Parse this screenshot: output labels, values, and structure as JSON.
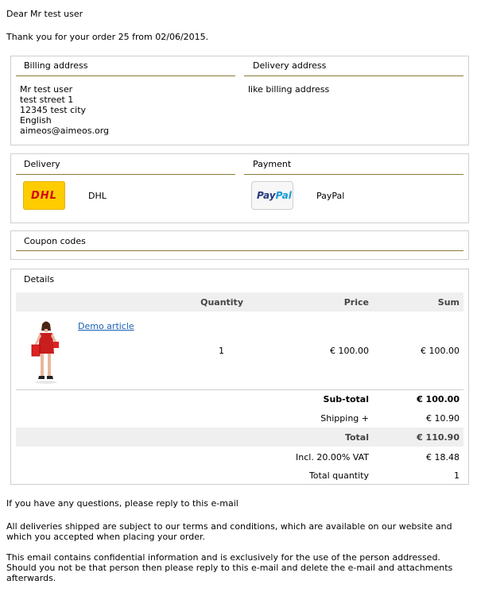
{
  "greeting": "Dear Mr test user",
  "thanks": "Thank you for your order 25 from 02/06/2015.",
  "billing": {
    "title": "Billing address",
    "lines": [
      "Mr test user",
      "test street 1",
      "12345 test city",
      "English",
      "aimeos@aimeos.org"
    ]
  },
  "delivery_address": {
    "title": "Delivery address",
    "text": "like billing address"
  },
  "delivery": {
    "title": "Delivery",
    "logo_text": "DHL",
    "name": "DHL",
    "icon": "dhl-logo"
  },
  "payment": {
    "title": "Payment",
    "logo_text_1": "Pay",
    "logo_text_2": "Pal",
    "name": "PayPal",
    "icon": "paypal-logo"
  },
  "coupon": {
    "title": "Coupon codes"
  },
  "details": {
    "title": "Details",
    "headers": {
      "quantity": "Quantity",
      "price": "Price",
      "sum": "Sum"
    },
    "item": {
      "name": "Demo article",
      "quantity": "1",
      "price": "€ 100.00",
      "sum": "€ 100.00"
    },
    "subtotal": {
      "label": "Sub-total",
      "value": "€ 100.00"
    },
    "shipping": {
      "label": "Shipping +",
      "value": "€ 10.90"
    },
    "total": {
      "label": "Total",
      "value": "€ 110.90"
    },
    "vat": {
      "label": "Incl. 20.00% VAT",
      "value": "€ 18.48"
    },
    "total_quantity": {
      "label": "Total quantity",
      "value": "1"
    }
  },
  "footer": {
    "questions": "If you have any questions, please reply to this e-mail",
    "terms_1": "All deliveries shipped are subject to our terms and conditions, which are available on our website and",
    "terms_2": "which you accepted when placing your order.",
    "confidential_1": "This email contains confidential information and is exclusively for the use of the person addressed.",
    "confidential_2": "Should you not be that person then please reply to this e-mail and delete the e-mail and attachments",
    "confidential_3": "afterwards."
  },
  "colors": {
    "rule": "#8a7a3a",
    "dhl_yellow": "#ffcc00",
    "dhl_red": "#d40511",
    "paypal_dark": "#253b80",
    "paypal_light": "#179bd7",
    "link": "#1a5fb4"
  }
}
